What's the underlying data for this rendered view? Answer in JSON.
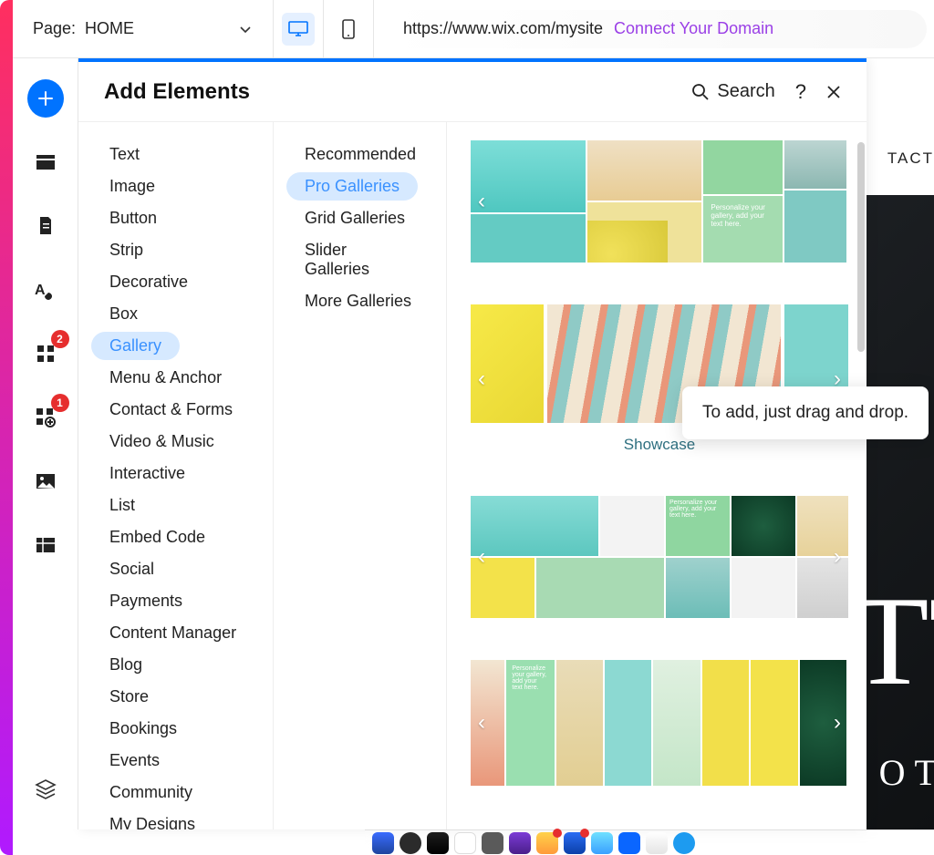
{
  "top": {
    "page_label_prefix": "Page: ",
    "page_name": "HOME",
    "url": "https://www.wix.com/mysite",
    "connect_domain": "Connect Your Domain"
  },
  "sidebar": {
    "badges": {
      "grid": "2",
      "plugins": "1"
    }
  },
  "panel": {
    "title": "Add Elements",
    "search_label": "Search",
    "categories": [
      "Text",
      "Image",
      "Button",
      "Strip",
      "Decorative",
      "Box",
      "Gallery",
      "Menu & Anchor",
      "Contact & Forms",
      "Video & Music",
      "Interactive",
      "List",
      "Embed Code",
      "Social",
      "Payments",
      "Content Manager",
      "Blog",
      "Store",
      "Bookings",
      "Events",
      "Community",
      "My Designs"
    ],
    "active_category": "Gallery",
    "subcategories": [
      "Recommended",
      "Pro Galleries",
      "Grid Galleries",
      "Slider Galleries",
      "More Galleries"
    ],
    "active_subcategory": "Pro Galleries",
    "gallery_personalize_text": "Personalize your gallery, add your text here.",
    "showcase_label": "Showcase",
    "tooltip": "To add, just drag and drop."
  },
  "canvas": {
    "nav_last": "TACT",
    "headline_fragment": "TT",
    "subhead_fragment": "OTOG"
  }
}
